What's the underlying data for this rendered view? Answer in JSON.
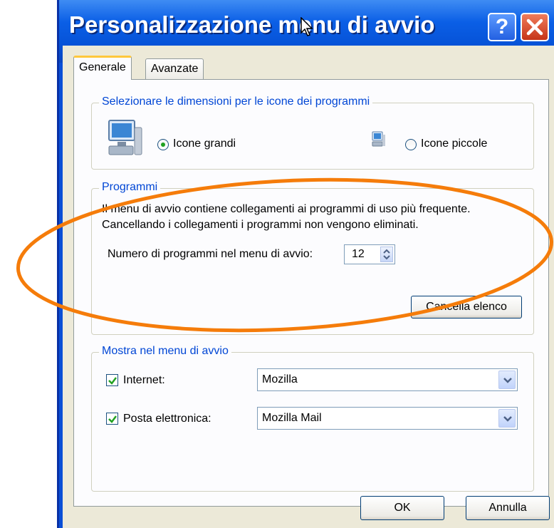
{
  "window": {
    "title": "Personalizzazione menu di avvio",
    "help_glyph": "?",
    "close_icon": "close-icon"
  },
  "tabs": [
    {
      "label": "Generale",
      "active": true
    },
    {
      "label": "Avanzate",
      "active": false
    }
  ],
  "icon_size_group": {
    "legend": "Selezionare le dimensioni per le icone dei programmi",
    "large_label": "Icone grandi",
    "small_label": "Icone piccole",
    "selected": "large"
  },
  "programs_group": {
    "legend": "Programmi",
    "description_line1": "Il menu di avvio contiene collegamenti ai programmi di uso più frequente.",
    "description_line2": "Cancellando i collegamenti i programmi non vengono eliminati.",
    "count_label": "Numero di programmi nel menu di avvio:",
    "count_value": "12",
    "clear_button": "Cancella elenco"
  },
  "show_group": {
    "legend": "Mostra nel menu di avvio",
    "internet": {
      "label": "Internet:",
      "checked": true,
      "value": "Mozilla"
    },
    "email": {
      "label": "Posta elettronica:",
      "checked": true,
      "value": "Mozilla Mail"
    }
  },
  "footer": {
    "ok": "OK",
    "cancel": "Annulla"
  },
  "colors": {
    "title_bar": "#0b5fe6",
    "legend_text": "#0046d5",
    "annotation_ellipse": "#f57c0a"
  }
}
